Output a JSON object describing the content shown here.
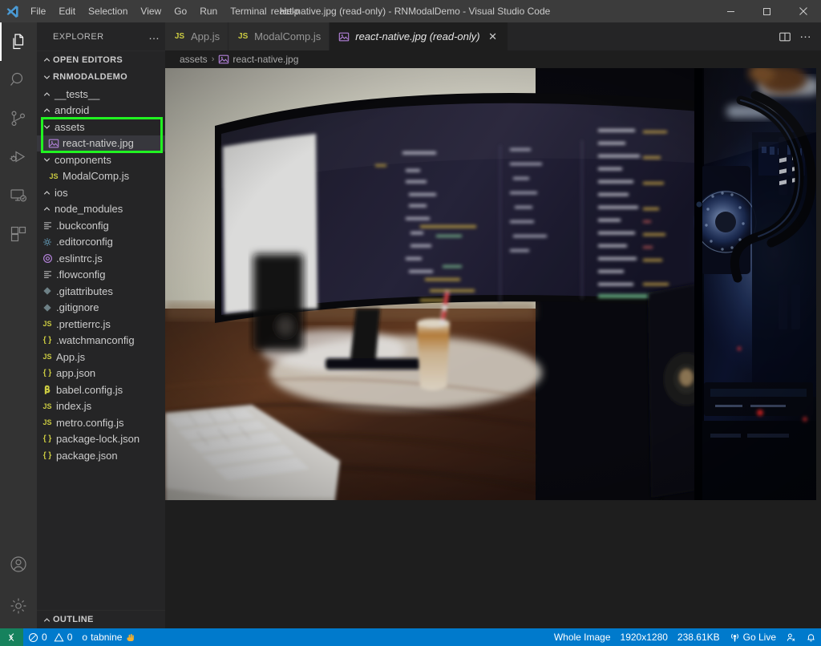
{
  "window": {
    "title": "react-native.jpg (read-only) - RNModalDemo - Visual Studio Code",
    "minimize_label": "Minimize",
    "maximize_label": "Maximize",
    "close_label": "Close"
  },
  "menubar": {
    "items": [
      {
        "label": "File"
      },
      {
        "label": "Edit"
      },
      {
        "label": "Selection"
      },
      {
        "label": "View"
      },
      {
        "label": "Go"
      },
      {
        "label": "Run"
      },
      {
        "label": "Terminal"
      },
      {
        "label": "Help"
      }
    ]
  },
  "activitybar": {
    "items": [
      {
        "name": "explorer",
        "icon": "files-icon",
        "active": true
      },
      {
        "name": "search",
        "icon": "search-icon",
        "active": false
      },
      {
        "name": "source-control",
        "icon": "source-control-icon",
        "active": false
      },
      {
        "name": "run-and-debug",
        "icon": "run-debug-icon",
        "active": false
      },
      {
        "name": "remote-explorer",
        "icon": "remote-explorer-icon",
        "active": false
      },
      {
        "name": "extensions",
        "icon": "extensions-icon",
        "active": false
      }
    ],
    "bottom_items": [
      {
        "name": "accounts",
        "icon": "account-icon"
      },
      {
        "name": "manage",
        "icon": "gear-icon"
      }
    ]
  },
  "sidebar": {
    "title": "EXPLORER",
    "more_actions": "…",
    "open_editors_label": "OPEN EDITORS",
    "project_label": "RNMODALDEMO",
    "outline_label": "OUTLINE",
    "tree": [
      {
        "label": "__tests__",
        "indent": 1,
        "type": "folder",
        "expanded": false,
        "icon": "folder-icon"
      },
      {
        "label": "android",
        "indent": 1,
        "type": "folder",
        "expanded": false,
        "icon": "folder-icon"
      },
      {
        "label": "assets",
        "indent": 1,
        "type": "folder",
        "expanded": true,
        "icon": "folder-open-icon",
        "highlighted": true
      },
      {
        "label": "react-native.jpg",
        "indent": 2,
        "type": "file",
        "icon": "image-file-icon",
        "selected": true,
        "highlighted": true
      },
      {
        "label": "components",
        "indent": 1,
        "type": "folder",
        "expanded": true,
        "icon": "folder-open-icon"
      },
      {
        "label": "ModalComp.js",
        "indent": 2,
        "type": "file",
        "icon": "js-file-icon"
      },
      {
        "label": "ios",
        "indent": 1,
        "type": "folder",
        "expanded": false,
        "icon": "folder-icon"
      },
      {
        "label": "node_modules",
        "indent": 1,
        "type": "folder",
        "expanded": false,
        "icon": "folder-icon"
      },
      {
        "label": ".buckconfig",
        "indent": 1,
        "type": "file",
        "icon": "config-file-icon"
      },
      {
        "label": ".editorconfig",
        "indent": 1,
        "type": "file",
        "icon": "editorconfig-file-icon"
      },
      {
        "label": ".eslintrc.js",
        "indent": 1,
        "type": "file",
        "icon": "eslint-file-icon"
      },
      {
        "label": ".flowconfig",
        "indent": 1,
        "type": "file",
        "icon": "config-file-icon"
      },
      {
        "label": ".gitattributes",
        "indent": 1,
        "type": "file",
        "icon": "git-file-icon"
      },
      {
        "label": ".gitignore",
        "indent": 1,
        "type": "file",
        "icon": "git-file-icon"
      },
      {
        "label": ".prettierrc.js",
        "indent": 1,
        "type": "file",
        "icon": "js-file-icon"
      },
      {
        "label": ".watchmanconfig",
        "indent": 1,
        "type": "file",
        "icon": "json-file-icon"
      },
      {
        "label": "App.js",
        "indent": 1,
        "type": "file",
        "icon": "js-file-icon"
      },
      {
        "label": "app.json",
        "indent": 1,
        "type": "file",
        "icon": "json-file-icon"
      },
      {
        "label": "babel.config.js",
        "indent": 1,
        "type": "file",
        "icon": "babel-file-icon"
      },
      {
        "label": "index.js",
        "indent": 1,
        "type": "file",
        "icon": "js-file-icon"
      },
      {
        "label": "metro.config.js",
        "indent": 1,
        "type": "file",
        "icon": "js-file-icon"
      },
      {
        "label": "package-lock.json",
        "indent": 1,
        "type": "file",
        "icon": "json-file-icon"
      },
      {
        "label": "package.json",
        "indent": 1,
        "type": "file",
        "icon": "json-file-icon"
      }
    ]
  },
  "editor": {
    "tabs": [
      {
        "label": "App.js",
        "icon": "js-file-icon",
        "active": false,
        "closable": false
      },
      {
        "label": "ModalComp.js",
        "icon": "js-file-icon",
        "active": false,
        "closable": false
      },
      {
        "label": "react-native.jpg (read-only)",
        "icon": "image-file-icon",
        "active": true,
        "closable": true
      }
    ],
    "close_glyph": "✕",
    "actions": [
      {
        "name": "split-editor-right",
        "icon": "split-editor-icon"
      },
      {
        "name": "more-actions",
        "icon": "ellipsis-icon",
        "glyph": "…"
      }
    ],
    "breadcrumbs": [
      {
        "label": "assets",
        "icon": ""
      },
      {
        "label": "react-native.jpg",
        "icon": "image-file-icon"
      }
    ],
    "breadcrumb_separator": "›",
    "image": {
      "alt": "Photo of an ultrawide curved monitor displaying code on a wooden desk with white keyboard, black mouse, iced latte, and an RGB-lit PC case with water cooling"
    }
  },
  "statusbar": {
    "remote_label": "",
    "problems": {
      "errors": "0",
      "warnings": "0"
    },
    "tabnine": "tabnine",
    "tabnine_prefix": "o",
    "zoom_label": "Whole Image",
    "dimensions": "1920x1280",
    "filesize": "238.61KB",
    "go_live": "Go Live",
    "accent_color": "#007acc",
    "remote_color": "#16825d"
  }
}
